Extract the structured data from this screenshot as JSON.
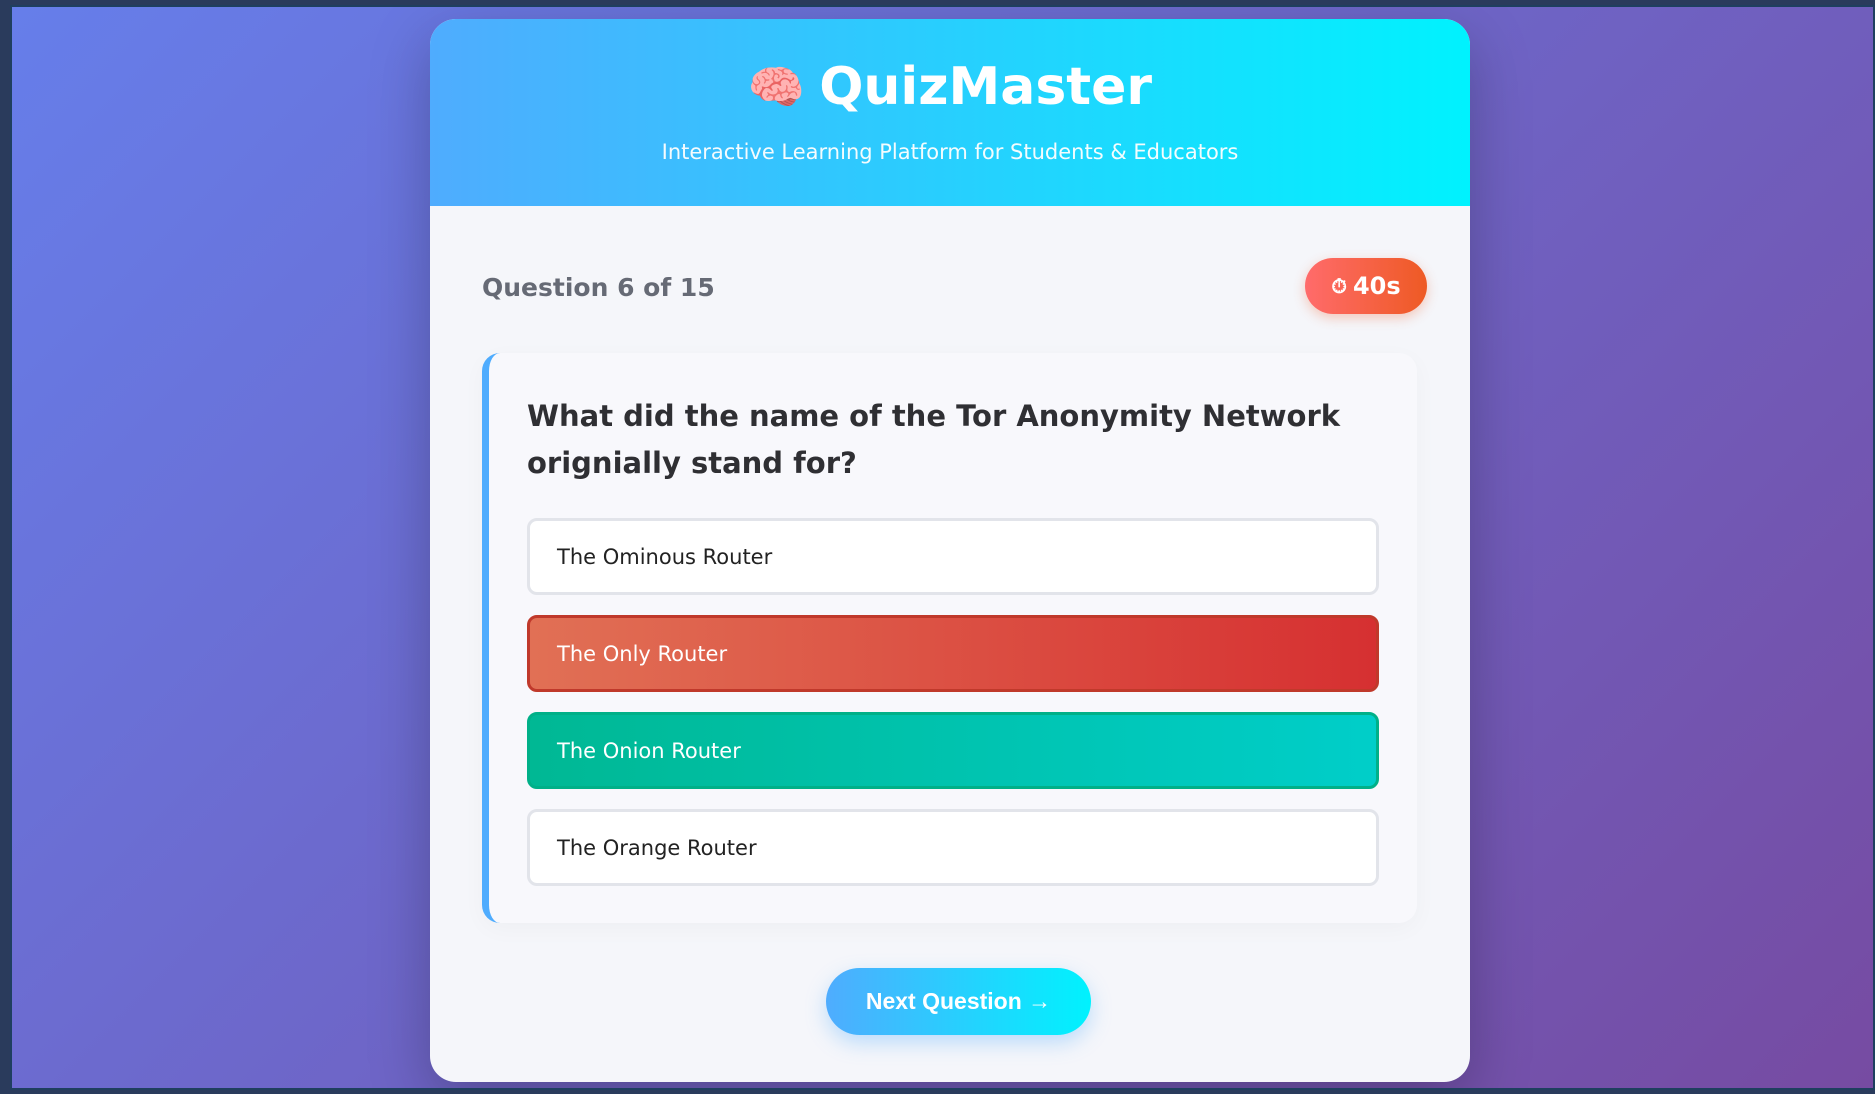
{
  "app": {
    "title": "QuizMaster",
    "icon": "🧠",
    "subtitle": "Interactive Learning Platform for Students & Educators"
  },
  "progress": {
    "label": "Question 6 of 15",
    "current": 6,
    "total": 15
  },
  "timer": {
    "icon": "⏱",
    "value": "40s"
  },
  "question": {
    "text": "What did the name of the Tor Anonymity Network orignially stand for?"
  },
  "options": [
    {
      "label": "The Ominous Router",
      "state": "default"
    },
    {
      "label": "The Only Router",
      "state": "wrong"
    },
    {
      "label": "The Onion Router",
      "state": "correct"
    },
    {
      "label": "The Orange Router",
      "state": "default"
    }
  ],
  "next_button": {
    "label": "Next Question →"
  },
  "colors": {
    "background_start": "#667eea",
    "background_end": "#764ba2",
    "header_start": "#4facfe",
    "header_end": "#00f2fe",
    "wrong": "#d63031",
    "correct": "#00b894",
    "timer": "#ee5a24"
  }
}
